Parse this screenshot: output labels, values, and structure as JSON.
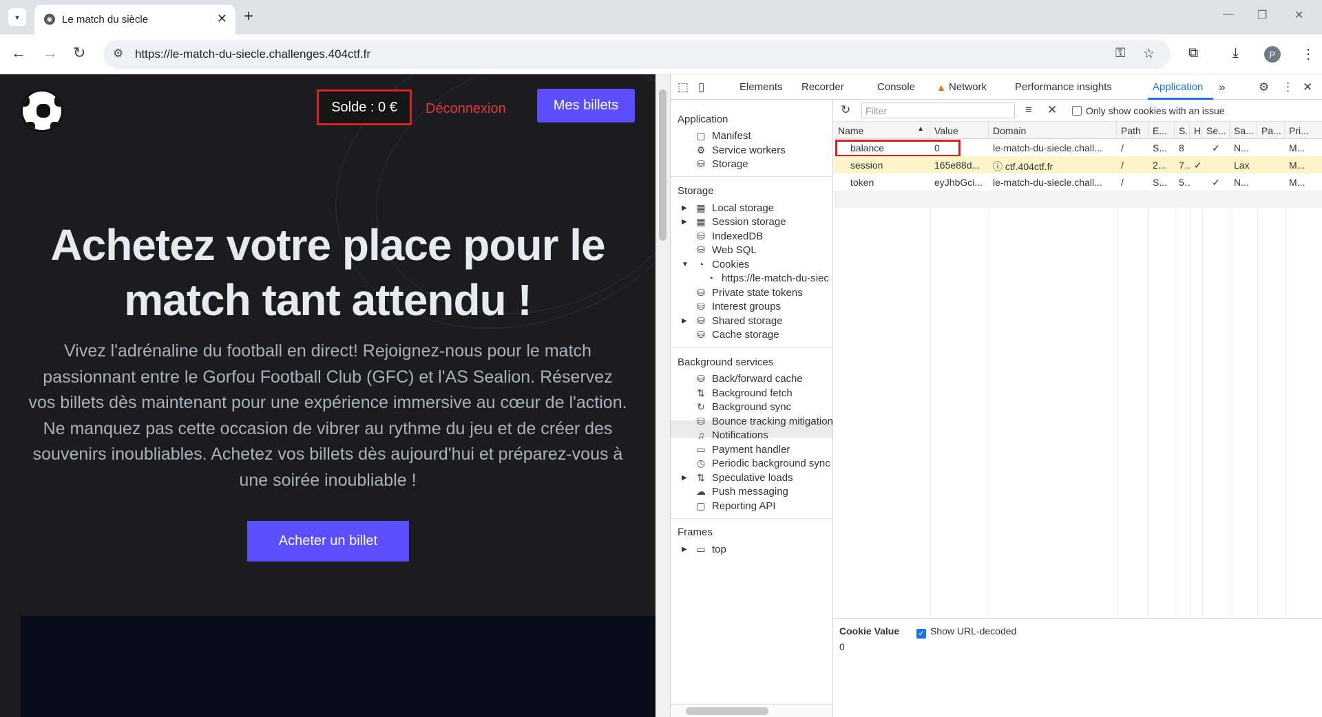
{
  "browser": {
    "tab_title": "Le match du siècle",
    "url": "https://le-match-du-siecle.challenges.404ctf.fr",
    "avatar_letter": "P"
  },
  "page": {
    "balance_label": "Solde : 0 €",
    "logout_label": "Déconnexion",
    "my_tickets_label": "Mes billets",
    "hero_title": "Achetez votre place pour le match tant attendu !",
    "description": "Vivez l'adrénaline du football en direct! Rejoignez-nous pour le match passionnant entre le Gorfou Football Club (GFC) et l'AS Sealion. Réservez vos billets dès maintenant pour une expérience immersive au cœur de l'action. Ne manquez pas cette occasion de vibrer au rythme du jeu et de créer des souvenirs inoubliables. Achetez vos billets dès aujourd'hui et préparez-vous à une soirée inoubliable !",
    "buy_button_label": "Acheter un billet",
    "accent_color": "#5b4eff",
    "logout_color": "#e03b3b"
  },
  "devtools": {
    "tabs": [
      "Elements",
      "Recorder",
      "Console",
      "Network",
      "Performance insights",
      "Application"
    ],
    "active_tab": "Application",
    "sidebar": {
      "application_heading": "Application",
      "application_items": [
        "Manifest",
        "Service workers",
        "Storage"
      ],
      "storage_heading": "Storage",
      "storage_items": [
        "Local storage",
        "Session storage",
        "IndexedDB",
        "Web SQL",
        "Cookies",
        "https://le-match-du-siec",
        "Private state tokens",
        "Interest groups",
        "Shared storage",
        "Cache storage"
      ],
      "background_heading": "Background services",
      "background_items": [
        "Back/forward cache",
        "Background fetch",
        "Background sync",
        "Bounce tracking mitigation",
        "Notifications",
        "Payment handler",
        "Periodic background sync",
        "Speculative loads",
        "Push messaging",
        "Reporting API"
      ],
      "frames_heading": "Frames",
      "frames_items": [
        "top"
      ]
    },
    "filter_placeholder": "Filter",
    "only_issue_label": "Only show cookies with an issue",
    "columns": [
      "Name",
      "Value",
      "Domain",
      "Path",
      "E...",
      "S.",
      "H",
      "Se...",
      "Sa...",
      "Pa...",
      "Pri..."
    ],
    "rows": [
      {
        "name": "balance",
        "value": "0",
        "domain": "le-match-du-siecle.chall...",
        "path": "/",
        "expires": "S...",
        "size": "8",
        "http": "",
        "secure": "✓",
        "samesite": "N...",
        "partition": "",
        "priority": "M..."
      },
      {
        "name": "session",
        "value": "165e88d...",
        "domain": "ⓘ ctf.404ctf.fr",
        "path": "/",
        "expires": "2...",
        "size": "7..",
        "http": "✓",
        "secure": "",
        "samesite": "Lax",
        "partition": "",
        "priority": "M..."
      },
      {
        "name": "token",
        "value": "eyJhbGci...",
        "domain": "le-match-du-siecle.chall...",
        "path": "/",
        "expires": "S...",
        "size": "5..",
        "http": "",
        "secure": "✓",
        "samesite": "N...",
        "partition": "",
        "priority": "M..."
      }
    ],
    "cookie_value_label": "Cookie Value",
    "show_decoded_label": "Show URL-decoded",
    "cookie_value": "0"
  }
}
